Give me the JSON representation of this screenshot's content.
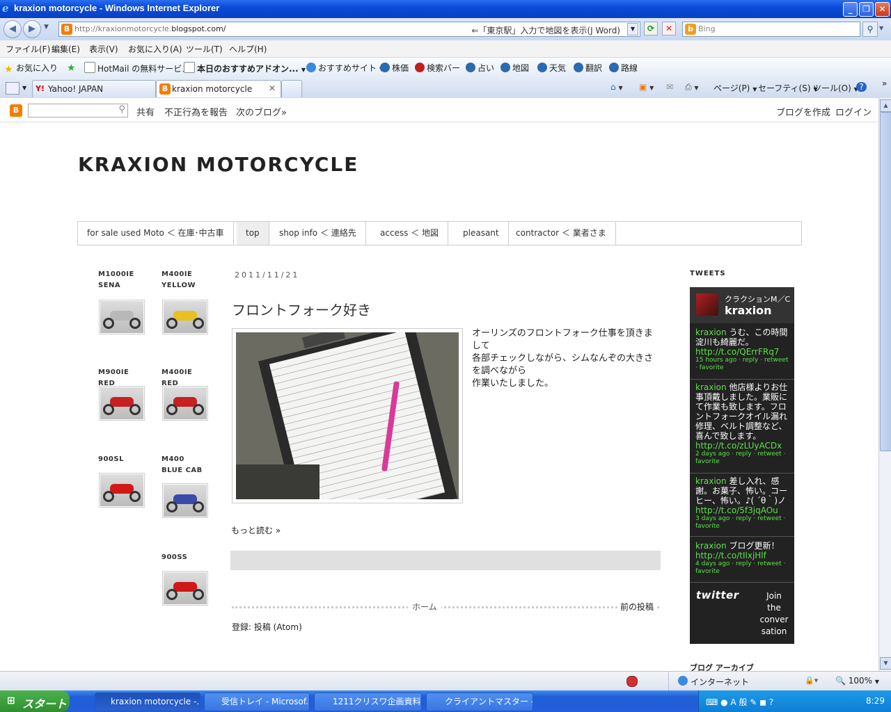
{
  "window": {
    "title": "kraxion motorcycle - Windows Internet Explorer"
  },
  "address": {
    "url_prefix": "http://kraxionmotorcycle.",
    "url_domain": "blogspot.com/",
    "hint": "⇐「東京駅」入力で地図を表示(J Word)",
    "search_placeholder": "Bing"
  },
  "menu": [
    "ファイル(F)",
    "編集(E)",
    "表示(V)",
    "お気に入り(A)",
    "ツール(T)",
    "ヘルプ(H)"
  ],
  "favorites": {
    "label": "お気に入り",
    "items": [
      "HotMail の無料サービス",
      "本日のおすすめアドオン...",
      "おすすめサイト",
      "株価",
      "検索バー",
      "占い",
      "地図",
      "天気",
      "翻訳",
      "路線"
    ]
  },
  "tabs": [
    "Yahoo! JAPAN",
    "kraxion motorcycle"
  ],
  "commands": [
    "ページ(P)",
    "セーフティ(S)",
    "ツール(O)"
  ],
  "navbar": {
    "share": "共有",
    "report": "不正行為を報告",
    "next": "次のブログ»",
    "create": "ブログを作成",
    "login": "ログイン"
  },
  "blog": {
    "title": "KRAXION MOTORCYCLE",
    "pages": [
      "for sale used Moto ＜ 在庫･中古車",
      "top",
      "shop info ＜ 連絡先",
      "access ＜ 地図",
      "pleasant",
      "contractor ＜ 業者さま"
    ]
  },
  "motos": [
    {
      "label": "M1000IE\nSENA",
      "color": "#b8b8b8"
    },
    {
      "label": "M400IE\nYELLOW",
      "color": "#e8c020"
    },
    {
      "label": "M900IE RED",
      "color": "#c82020"
    },
    {
      "label": "M400IE RED",
      "color": "#c82020"
    },
    {
      "label": "900SL",
      "color": "#d01818"
    },
    {
      "label": "M400\nBLUE CAB",
      "color": "#3a4aa8"
    },
    {
      "label": "900SS",
      "color": "#d01818"
    }
  ],
  "post": {
    "date": "2011/11/21",
    "title": "フロントフォーク好き",
    "text1": "オーリンズのフロントフォーク仕事を頂きまして",
    "text2": "各部チェックしながら、シムなんぞの大きさを調べながら",
    "text3": "作業いたしました。",
    "more": "もっと読む »"
  },
  "pager": {
    "home": "ホーム",
    "prev": "前の投稿"
  },
  "feed": {
    "label": "登録: ",
    "link": "投稿 (Atom)"
  },
  "tweets": {
    "heading": "TWEETS",
    "display_name": "クラクションM／C",
    "handle": "kraxion",
    "items": [
      {
        "user": "kraxion",
        "text": " うむ、この時間淀川も綺麗だ。",
        "link": "http://t.co/QErrFRq7",
        "meta": "15 hours ago · reply · retweet · favorite"
      },
      {
        "user": "kraxion",
        "text": " 他店様よりお仕事頂戴しました。業販にて作業も致します。フロントフォークオイル漏れ修理、ベルト調整など、喜んで致します。",
        "link": "http://t.co/zLUyACDx",
        "meta": "2 days ago · reply · retweet · favorite"
      },
      {
        "user": "kraxion",
        "text": " 差し入れ、感謝。お菓子、怖い。コーヒー、怖い。♪( ´θ｀)ノ",
        "link": "http://t.co/5f3jqAOu",
        "meta": "3 days ago · reply · retweet · favorite"
      },
      {
        "user": "kraxion",
        "text": " ブログ更新！",
        "link": "http://t.co/tIlxjHlf",
        "meta": "4 days ago · reply · retweet · favorite"
      }
    ],
    "twitter_logo": "twitter",
    "join": "Join the conver sation"
  },
  "archive_heading": "ブログ アーカイブ",
  "status": {
    "zone": "インターネット",
    "zoom": "100%"
  },
  "taskbar": {
    "start": "スタート",
    "tasks": [
      "kraxion motorcycle -...",
      "受信トレイ - Microsof...",
      "1211クリスワ企画資料...",
      "クライアントマスター - ..."
    ],
    "clock": "8:29"
  }
}
